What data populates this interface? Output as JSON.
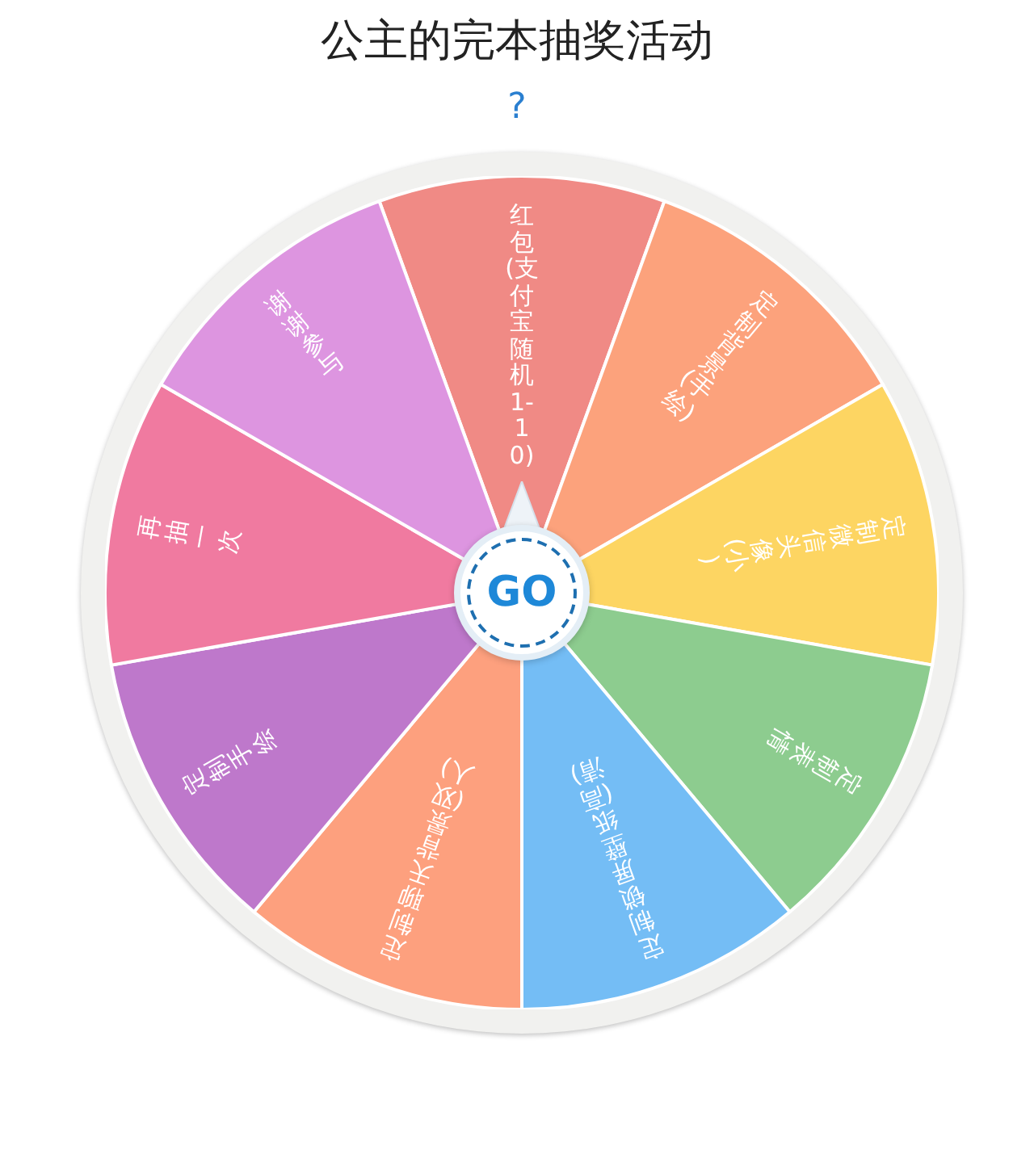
{
  "title": "公主的完本抽奖活动",
  "help_link": "?",
  "wheel": {
    "button": "GO",
    "segments": [
      {
        "label": "红包(支付宝随机1-10)",
        "color": "#f08a85"
      },
      {
        "label": "定制背景(手绘)",
        "color": "#fca27c"
      },
      {
        "label": "定制微信头像(小)",
        "color": "#fdd562"
      },
      {
        "label": "定制表情",
        "color": "#8dcc8f"
      },
      {
        "label": "定制锁屏壁纸(高清)",
        "color": "#74bdf5"
      },
      {
        "label": "定制聊天背景(双人)",
        "color": "#fda07e"
      },
      {
        "label": "定制手绘",
        "color": "#be78cb"
      },
      {
        "label": "再抽一次",
        "color": "#f07aa0"
      },
      {
        "label": "谢谢参与",
        "color": "#dd95e0"
      }
    ]
  }
}
